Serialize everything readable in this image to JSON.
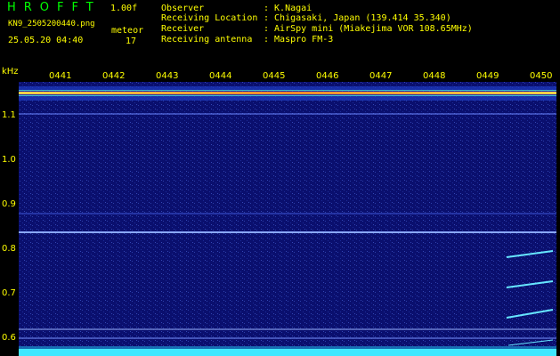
{
  "header": {
    "brand": "HROFFT",
    "version": "1.00f",
    "filename": "KN9_2505200440.png",
    "mode": "meteor",
    "timestamp": "25.05.20 04:40",
    "count": "17",
    "info": [
      {
        "label": "Observer",
        "value": ": K.Nagai"
      },
      {
        "label": "Receiving Location",
        "value": ": Chigasaki, Japan (139.414 35.340)"
      },
      {
        "label": "Receiver",
        "value": ": AirSpy mini (Miakejima VOR 108.65MHz)"
      },
      {
        "label": "Receiving antenna",
        "value": ": Maspro FM-3"
      }
    ]
  },
  "axes": {
    "unit": "kHz",
    "y_ticks": [
      "1.1",
      "1.0",
      "0.9",
      "0.8",
      "0.7",
      "0.6"
    ],
    "x_ticks": [
      "0441",
      "0442",
      "0443",
      "0444",
      "0445",
      "0446",
      "0447",
      "0448",
      "0449",
      "0450"
    ]
  },
  "colors": {
    "background": "#0a0f6e",
    "label": "#ffff00",
    "brand": "#00ff00"
  }
}
